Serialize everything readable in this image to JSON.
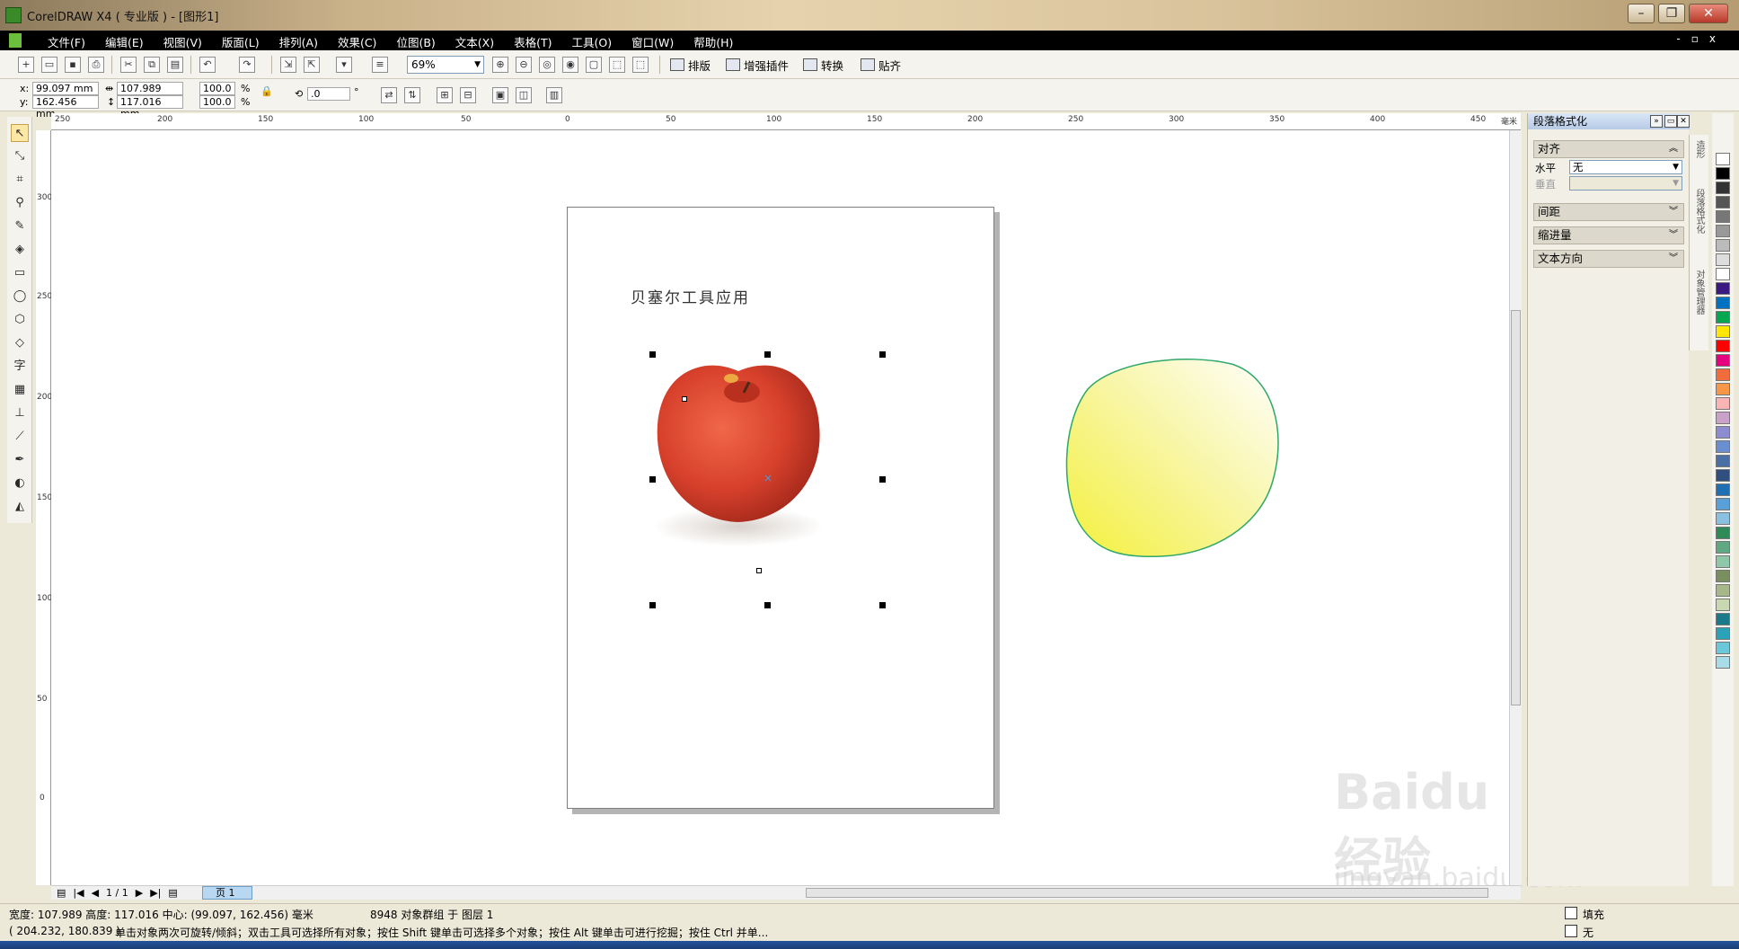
{
  "window": {
    "title": "CorelDRAW X4 ( 专业版 ) - [图形1]"
  },
  "menu": [
    "文件(F)",
    "编辑(E)",
    "视图(V)",
    "版面(L)",
    "排列(A)",
    "效果(C)",
    "位图(B)",
    "文本(X)",
    "表格(T)",
    "工具(O)",
    "窗口(W)",
    "帮助(H)"
  ],
  "toolbar": {
    "zoom": "69%",
    "buttons": {
      "layout": "排版",
      "plugins": "增强插件",
      "convert": "转换",
      "snap": "贴齐"
    }
  },
  "property_bar": {
    "x": "99.097 mm",
    "y": "162.456 mm",
    "width": "107.989 mm",
    "height": "117.016 mm",
    "scale_x": "100.0",
    "scale_y": "100.0",
    "percent": "%",
    "angle": ".0",
    "degree": "°"
  },
  "rulers": {
    "top": [
      "250",
      "200",
      "150",
      "100",
      "50",
      "0",
      "50",
      "100",
      "150",
      "200",
      "250",
      "300",
      "350",
      "400",
      "450"
    ],
    "unit": "毫米",
    "left": [
      "300",
      "250",
      "200",
      "150",
      "100",
      "50",
      "0"
    ]
  },
  "page": {
    "heading": "贝塞尔工具应用"
  },
  "colors": {
    "apple_red": "#d8412c",
    "shape_yellow": "#f4f03c",
    "shape_outline": "#2fa86a",
    "selected_tab": "#b8d8f2"
  },
  "docker": {
    "title": "段落格式化",
    "sections": {
      "align": "对齐",
      "spacing": "间距",
      "indent": "缩进量",
      "direction": "文本方向"
    },
    "horizontal_label": "水平",
    "horizontal_value": "无",
    "vertical_label": "垂直",
    "tabs": [
      "造形",
      "段落格式化",
      "对象管理器"
    ]
  },
  "page_nav": {
    "counter": "1 / 1",
    "tab": "页 1"
  },
  "status": {
    "dimensions": "宽度: 107.989  高度: 117.016  中心: (99.097, 162.456)  毫米",
    "selection": "8948 对象群组 于 图层 1",
    "cursor": "( 204.232, 180.839 )",
    "hint": "单击对象两次可旋转/倾斜；双击工具可选择所有对象；按住 Shift 键单击可选择多个对象；按住 Alt 键单击可进行挖掘；按住 Ctrl 并单...",
    "fill": "填充",
    "outline": "无"
  },
  "watermark": {
    "brand": "Baidu经验",
    "url": "jingyan.baidu.com"
  }
}
